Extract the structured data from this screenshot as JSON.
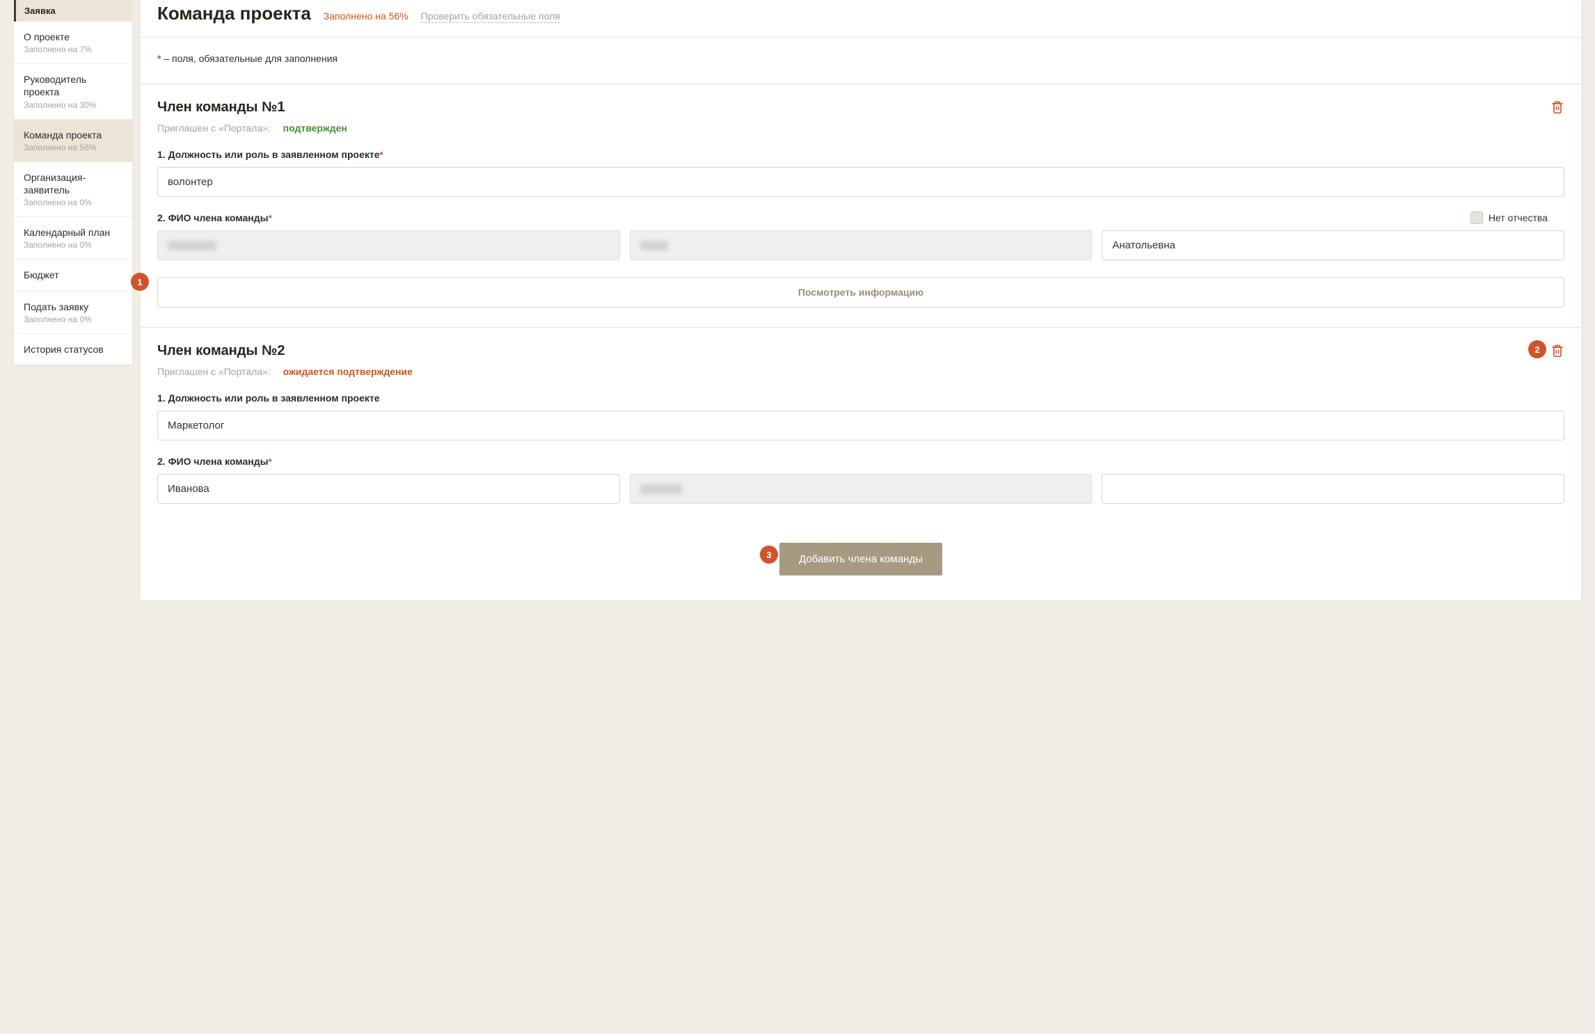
{
  "sidebar": {
    "header": "Заявка",
    "items": [
      {
        "title": "О проекте",
        "sub": "Заполнено на 7%"
      },
      {
        "title": "Руководитель проекта",
        "sub": "Заполнено на 30%"
      },
      {
        "title": "Команда проекта",
        "sub": "Заполнено на 56%"
      },
      {
        "title": "Организация-заявитель",
        "sub": "Заполнено на 0%"
      },
      {
        "title": "Календарный план",
        "sub": "Заполнено на 0%"
      },
      {
        "title": "Бюджет",
        "sub": ""
      },
      {
        "title": "Подать заявку",
        "sub": "Заполнено на 0%"
      },
      {
        "title": "История статусов",
        "sub": ""
      }
    ]
  },
  "header": {
    "title": "Команда проекта",
    "fill_status": "Заполнено на 56%",
    "check_link": "Проверить обязательные поля"
  },
  "required_note": "– поля, обязательные для заполнения",
  "labels": {
    "role": "1. Должность или роль в заявленном проекте",
    "fio": "2. ФИО члена команды",
    "no_patronymic": "Нет отчества",
    "invite_label": "Приглашен с «Портала»:",
    "view_info": "Посмотреть информацию",
    "add_member": "Добавить члена команды"
  },
  "members": [
    {
      "title": "Член команды №1",
      "invite_status": "подтвержден",
      "invite_status_class": "confirmed",
      "role_required": true,
      "role": "волонтер",
      "show_no_patronymic": true,
      "last_name": "",
      "first_name": "",
      "patronymic": "Анатольевна",
      "last_name_readonly": true,
      "first_name_readonly": true,
      "patronymic_readonly": false,
      "show_view_info": true
    },
    {
      "title": "Член команды №2",
      "invite_status": "ожидается подтверждение",
      "invite_status_class": "pending",
      "role_required": false,
      "role": "Маркетолог",
      "show_no_patronymic": false,
      "last_name": "Иванова",
      "first_name": "",
      "patronymic": "",
      "last_name_readonly": false,
      "first_name_readonly": true,
      "patronymic_readonly": false,
      "show_view_info": false
    }
  ],
  "annotations": {
    "a1": "1",
    "a2": "2",
    "a3": "3"
  }
}
